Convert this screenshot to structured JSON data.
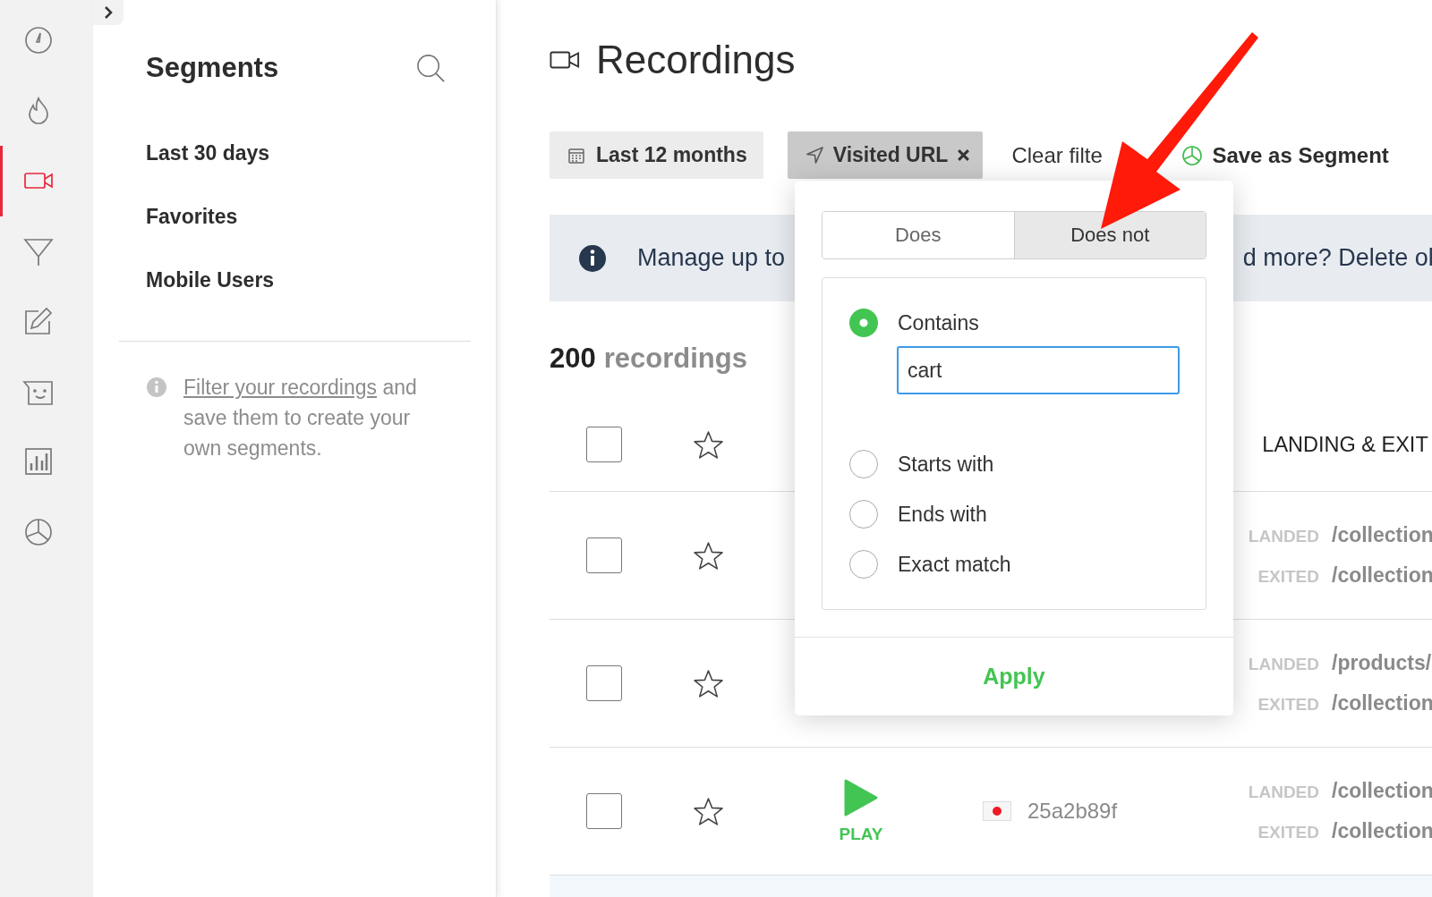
{
  "rail": {
    "items": [
      {
        "kind": "gauge",
        "selected": false
      },
      {
        "kind": "flame",
        "selected": false
      },
      {
        "kind": "video",
        "selected": true
      },
      {
        "kind": "funnel",
        "selected": false
      },
      {
        "kind": "edit",
        "selected": false
      },
      {
        "kind": "feedback",
        "selected": false
      },
      {
        "kind": "chart",
        "selected": false
      },
      {
        "kind": "pie",
        "selected": false
      }
    ]
  },
  "segments": {
    "title": "Segments",
    "items": [
      "Last 30 days",
      "Favorites",
      "Mobile Users"
    ],
    "hint": {
      "link": "Filter your recordings",
      "text": "and save them to create your own segments."
    }
  },
  "page": {
    "title": "Recordings"
  },
  "filters": [
    {
      "kind": "date",
      "label": "Last 12 months",
      "active": false
    },
    {
      "kind": "url",
      "label": "Visited URL",
      "active": true
    }
  ],
  "clear_filters": "Clear filte",
  "save_segment": "Save as Segment",
  "banner": {
    "text_left": "Manage up to",
    "text_right": "d more? Delete ol"
  },
  "count": {
    "number": "200",
    "label": "recordings"
  },
  "table": {
    "columns": [
      {
        "label": "LANDING & EXIT"
      }
    ],
    "header_checked": false,
    "header_favorite": false,
    "rows": [
      {
        "checked": false,
        "favorite": false,
        "pages": [
          {
            "label": "LANDED",
            "path": "/collection"
          },
          {
            "label": "EXITED",
            "path": "/collection"
          }
        ]
      },
      {
        "checked": false,
        "favorite": false,
        "pages": [
          {
            "label": "LANDED",
            "path": "/products/"
          },
          {
            "label": "EXITED",
            "path": "/collection"
          }
        ]
      },
      {
        "checked": false,
        "favorite": false,
        "play_label": "PLAY",
        "visitor": "25a2b89f",
        "pages": [
          {
            "label": "LANDED",
            "path": "/collection"
          },
          {
            "label": "EXITED",
            "path": "/collection"
          }
        ]
      }
    ]
  },
  "popup": {
    "modes": [
      {
        "label": "Does",
        "selected": false
      },
      {
        "label": "Does not",
        "selected": true
      }
    ],
    "options": [
      {
        "label": "Contains",
        "selected": true
      },
      {
        "label": "Starts with",
        "selected": false
      },
      {
        "label": "Ends with",
        "selected": false
      },
      {
        "label": "Exact match",
        "selected": false
      }
    ],
    "value": "cart",
    "apply": "Apply"
  }
}
